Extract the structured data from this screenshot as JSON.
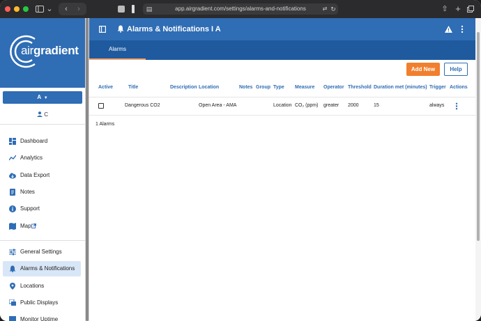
{
  "browser": {
    "url": "app.airgradient.com/settings/alarms-and-notifications"
  },
  "brand": {
    "logo_regular": "air",
    "logo_bold": "gradient"
  },
  "sidebar": {
    "org_label": "A",
    "user_label": "C",
    "items": [
      {
        "label": "Dashboard",
        "icon": "dashboard-icon"
      },
      {
        "label": "Analytics",
        "icon": "analytics-icon"
      },
      {
        "label": "Data Export",
        "icon": "cloud-download-icon"
      },
      {
        "label": "Notes",
        "icon": "notes-icon"
      },
      {
        "label": "Support",
        "icon": "info-icon"
      },
      {
        "label": "Map",
        "icon": "map-icon"
      },
      {
        "label": "General Settings",
        "icon": "sliders-icon"
      },
      {
        "label": "Alarms & Notifications",
        "icon": "bell-icon",
        "active": true
      },
      {
        "label": "Locations",
        "icon": "location-pin-icon"
      },
      {
        "label": "Public Displays",
        "icon": "displays-icon"
      },
      {
        "label": "Monitor Uptime",
        "icon": "uptime-icon"
      }
    ]
  },
  "header": {
    "title": "Alarms & Notifications I A"
  },
  "tabs": [
    {
      "label": "Alarms",
      "active": true
    }
  ],
  "toolbar": {
    "add_label": "Add New",
    "help_label": "Help"
  },
  "table": {
    "columns": [
      "Active",
      "Title",
      "Description",
      "Location",
      "Notes",
      "Group",
      "Type",
      "Measure",
      "Operator",
      "Threshold",
      "Duration met (minutes)",
      "Trigger",
      "Actions"
    ],
    "rows": [
      {
        "title": "Dangerous CO2",
        "description": "",
        "location": "Open Area - AMA",
        "notes": "",
        "group": "",
        "type": "Location",
        "measure": "CO₂ (ppm)",
        "operator": "greater",
        "threshold": "2000",
        "duration": "15",
        "trigger": "always"
      }
    ],
    "count_text": "1 Alarms"
  },
  "colors": {
    "primary": "#2f6db5",
    "tab_bar": "#1f5a9e",
    "accent": "#f07f2e",
    "active_nav": "#d8e6f7"
  }
}
